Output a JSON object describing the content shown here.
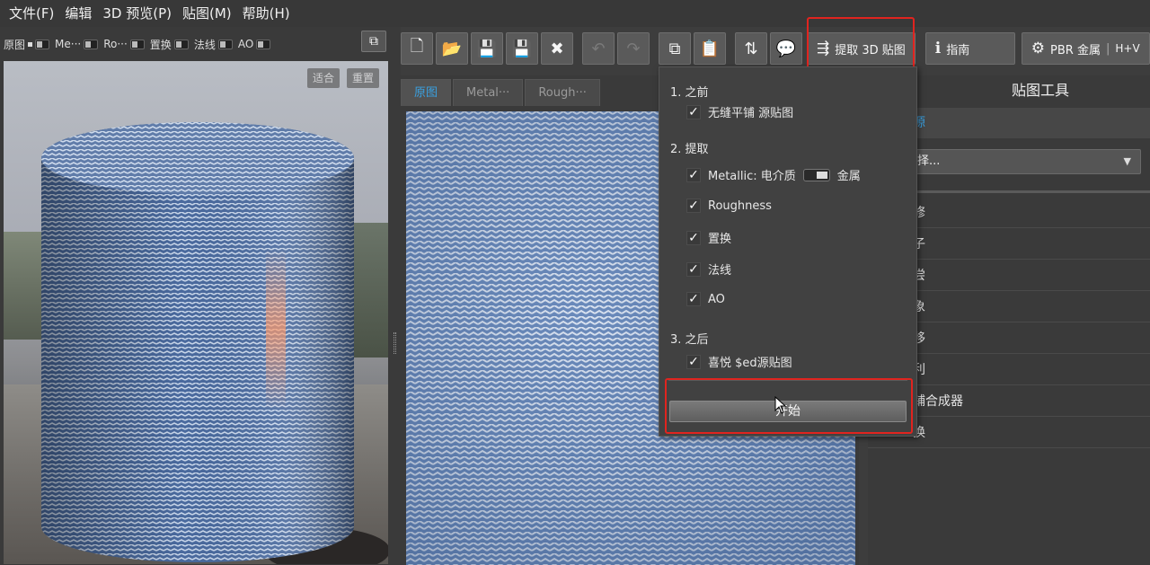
{
  "menu": {
    "items": [
      "文件(F)",
      "编辑",
      "3D 预览(P)",
      "贴图(M)",
      "帮助(H)"
    ]
  },
  "preview": {
    "toolbar": {
      "items": [
        "原图",
        "Me···",
        "Ro···",
        "置换",
        "法线",
        "AO"
      ]
    },
    "fit_label": "适合",
    "reset_label": "重置"
  },
  "toolbar": {
    "extract_label": "提取 3D 贴图",
    "guide_label": "指南",
    "pbr_label": "PBR 金属",
    "pbr_suffix": "H+V"
  },
  "tabs": [
    "原图",
    "Metal···",
    "Rough···"
  ],
  "dropdown": {
    "section1": "1. 之前",
    "before_item": "无缝平铺 源贴图",
    "section2": "2. 提取",
    "metallic_label": "Metallic: 电介质",
    "metallic_right": "金属",
    "extract_items": [
      "Roughness",
      "置换",
      "法线",
      "AO"
    ],
    "section3": "3. 之后",
    "after_item": "喜悦 $ed源贴图",
    "start_label": "开始"
  },
  "right_panel": {
    "title": "贴图工具",
    "source_label": "源",
    "select_value": "择...",
    "items": [
      "修",
      "子",
      "尝",
      "象",
      "移",
      "利",
      "铺合成器",
      "换"
    ]
  },
  "colors": {
    "accent": "#3aa0e0",
    "highlight": "#e0241f",
    "denim": "#4a6a9e"
  }
}
